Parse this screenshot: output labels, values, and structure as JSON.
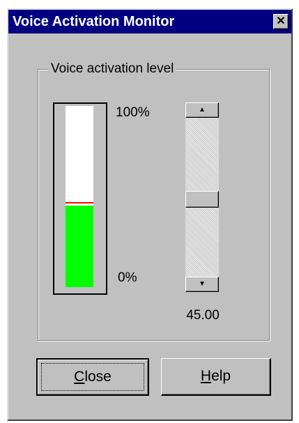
{
  "window": {
    "title": "Voice Activation Monitor",
    "close_glyph": "✕",
    "close_icon": "close-icon"
  },
  "group": {
    "label": "Voice activation level"
  },
  "meter": {
    "top_label": "100%",
    "bottom_label": "0%",
    "level_fraction": 0.45,
    "fill_color": "#00ff00",
    "threshold_color": "#ff0000"
  },
  "scrollbar": {
    "up_glyph": "▲",
    "down_glyph": "▼",
    "up_icon": "arrow-up-icon",
    "down_icon": "arrow-down-icon"
  },
  "level": {
    "value": "45.00"
  },
  "buttons": {
    "close": {
      "mnemonic": "C",
      "rest": "lose"
    },
    "help": {
      "mnemonic": "H",
      "rest": "elp"
    }
  },
  "colors": {
    "titlebar": "#000080",
    "face": "#c0c0c0"
  }
}
